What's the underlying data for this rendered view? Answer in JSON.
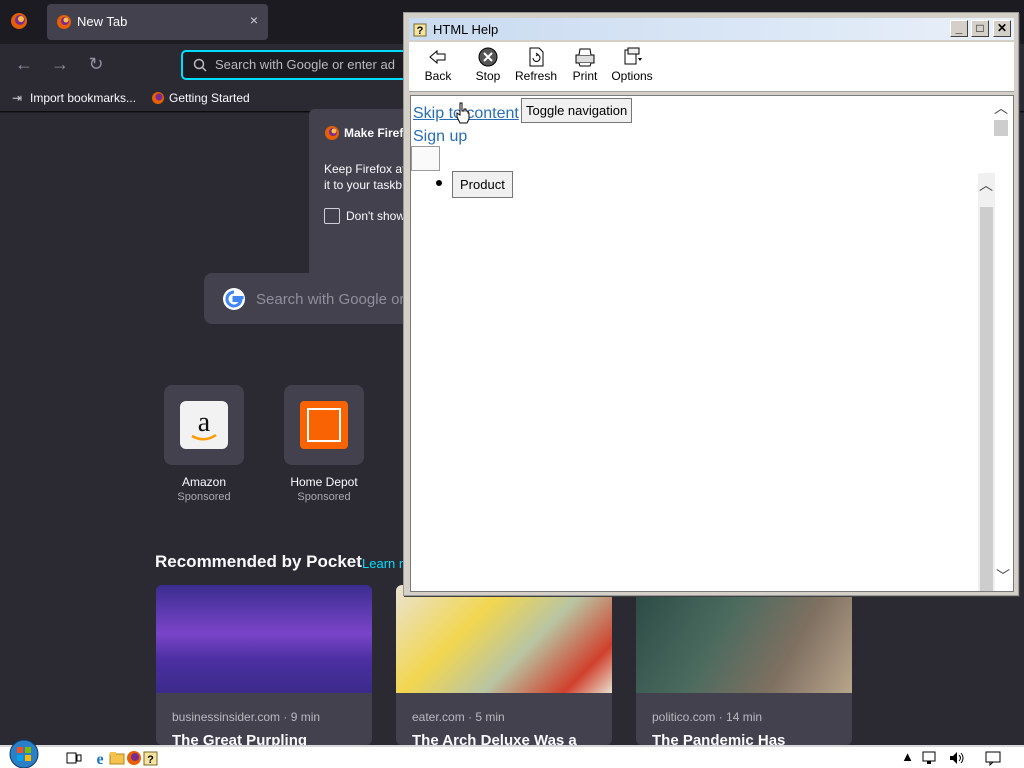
{
  "firefox": {
    "tab": {
      "title": "New Tab",
      "close": "×"
    },
    "navbar": {
      "back": "←",
      "forward": "→",
      "reload": "↻",
      "url_placeholder": "Search with Google or enter ad"
    },
    "bookmarks": [
      {
        "label": "Import bookmarks...",
        "icon": "import-icon"
      },
      {
        "label": "Getting Started",
        "icon": "firefox-icon"
      }
    ],
    "popup": {
      "title": "Make Firefo",
      "body_line1": "Keep Firefox at",
      "body_line2": "it to your taskb",
      "checkbox_label": "Don't show"
    },
    "search": {
      "placeholder": "Search with Google or"
    },
    "top_sites": [
      {
        "label": "Amazon",
        "sub": "Sponsored",
        "icon": "amazon-icon"
      },
      {
        "label": "Home Depot",
        "sub": "Sponsored",
        "icon": "home-depot-icon"
      }
    ],
    "pocket": {
      "heading": "Recommended by Pocket",
      "learn": "Learn m",
      "cards": [
        {
          "meta": "businessinsider.com · 9 min",
          "title": "The Great Purpling"
        },
        {
          "meta": "eater.com · 5 min",
          "title": "The Arch Deluxe Was a"
        },
        {
          "meta": "politico.com · 14 min",
          "title": "The Pandemic Has"
        }
      ]
    }
  },
  "help_window": {
    "title": "HTML Help",
    "caption": {
      "minimize": "_",
      "maximize": "□",
      "close": "✕"
    },
    "toolbar": [
      {
        "label": "Back",
        "icon": "back-arrow-icon"
      },
      {
        "label": "Stop",
        "icon": "stop-icon"
      },
      {
        "label": "Refresh",
        "icon": "refresh-icon"
      },
      {
        "label": "Print",
        "icon": "printer-icon"
      },
      {
        "label": "Options",
        "icon": "options-icon"
      }
    ],
    "content": {
      "skip_link": "Skip to content",
      "toggle_button": "Toggle navigation",
      "signup_link": "Sign up",
      "product_button": "Product"
    },
    "scroll": {
      "up": "︿",
      "down": "﹀"
    }
  },
  "taskbar": {
    "icons": [
      "start-orb-icon",
      "task-view-icon",
      "ie-icon",
      "explorer-icon",
      "firefox-icon",
      "help-icon"
    ],
    "tray": [
      "chevron-up-icon",
      "network-icon",
      "volume-icon",
      "notifications-icon"
    ]
  },
  "colors": {
    "accent": "#00ddff",
    "link": "#2a6db5",
    "ff_bg": "#2b2a33"
  }
}
